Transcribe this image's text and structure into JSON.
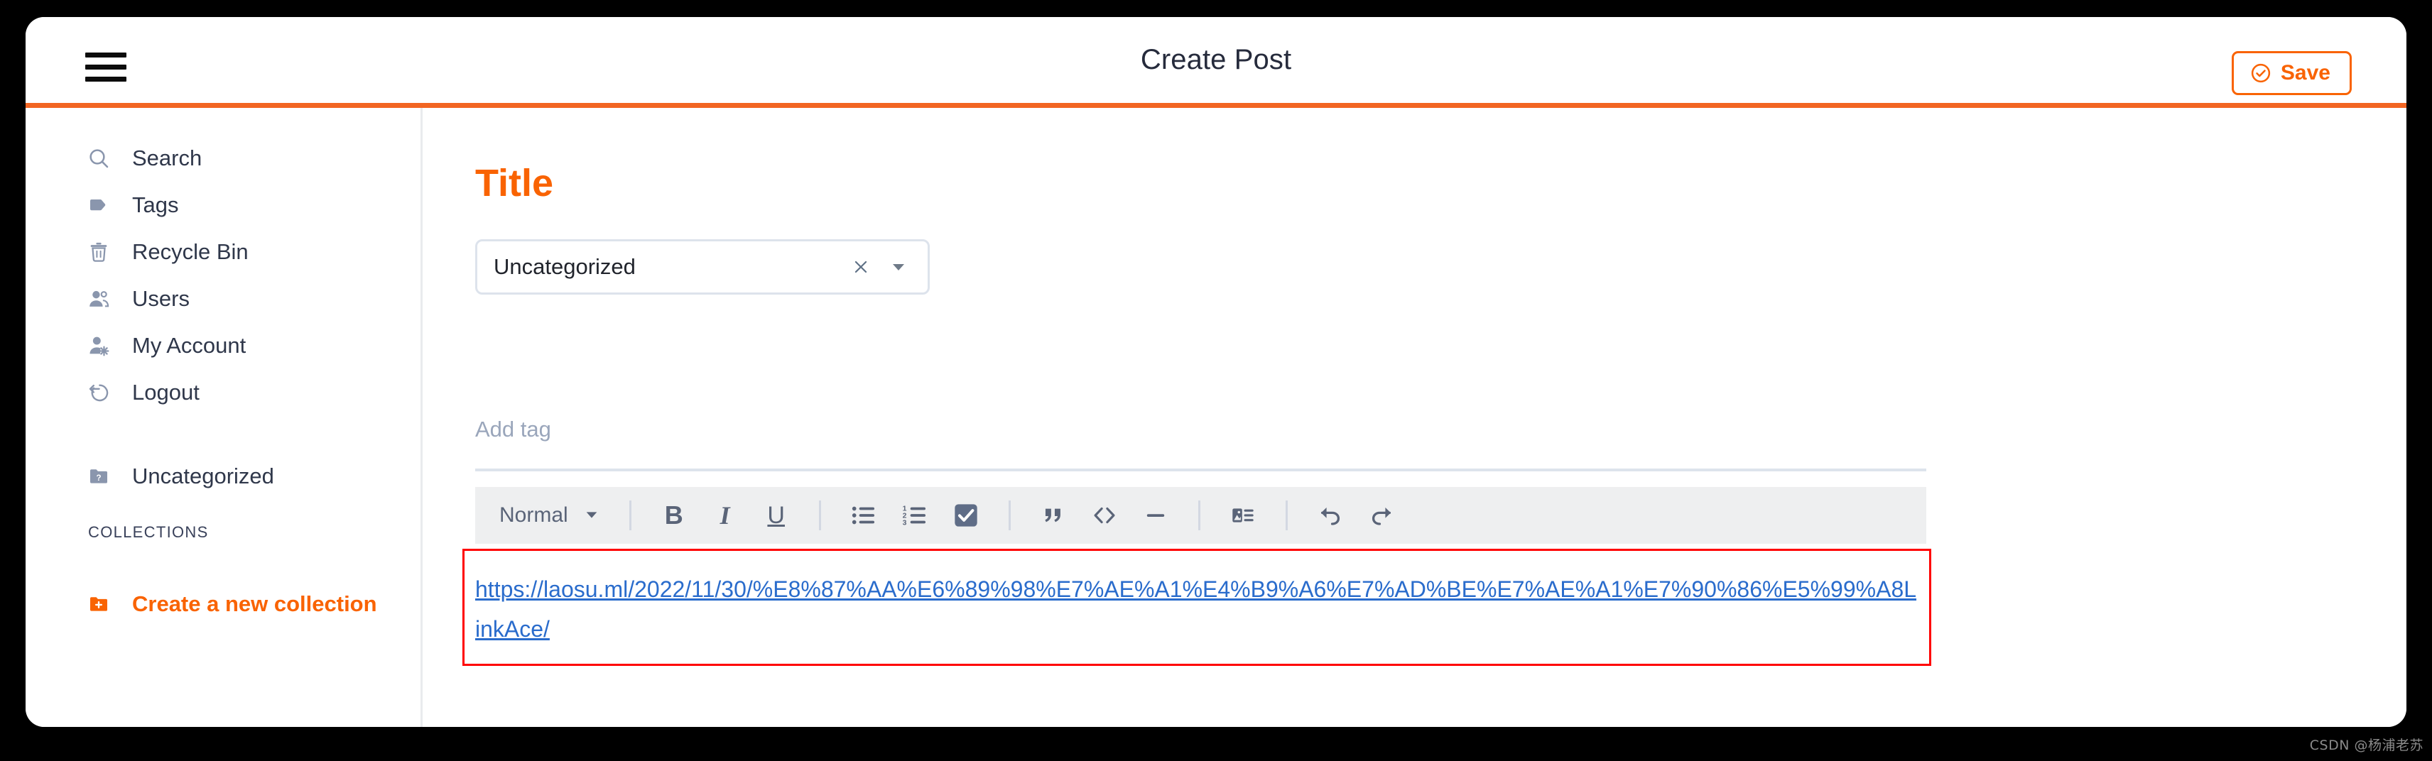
{
  "header": {
    "menu_icon": "hamburger-icon",
    "title": "Create Post",
    "save_label": "Save",
    "save_icon": "check-circle-icon",
    "accent_color": "#f96302",
    "divider_color": "#f26522"
  },
  "sidebar": {
    "items": [
      {
        "label": "Search",
        "icon": "search-icon"
      },
      {
        "label": "Tags",
        "icon": "tag-icon"
      },
      {
        "label": "Recycle Bin",
        "icon": "trash-icon"
      },
      {
        "label": "Users",
        "icon": "users-icon"
      },
      {
        "label": "My Account",
        "icon": "user-gear-icon"
      },
      {
        "label": "Logout",
        "icon": "logout-icon"
      }
    ],
    "collection_item": {
      "label": "Uncategorized",
      "icon": "folder-question-icon"
    },
    "collections_heading": "COLLECTIONS",
    "create_collection": {
      "label": "Create a new collection",
      "icon": "folder-plus-icon",
      "color": "#f96302"
    }
  },
  "main": {
    "title_field": {
      "value": "",
      "placeholder": "Title",
      "color": "#f96302"
    },
    "category_select": {
      "value": "Uncategorized",
      "clear_icon": "close-icon",
      "caret_icon": "chevron-down-icon"
    },
    "tag_field": {
      "value": "",
      "placeholder": "Add tag"
    },
    "toolbar": {
      "format": {
        "label": "Normal",
        "caret_icon": "chevron-down-icon"
      },
      "buttons": [
        {
          "name": "bold",
          "glyph": "B",
          "icon": "bold-icon"
        },
        {
          "name": "italic",
          "glyph": "I",
          "icon": "italic-icon"
        },
        {
          "name": "underline",
          "glyph": "U",
          "icon": "underline-icon"
        },
        {
          "name": "bullet-list",
          "glyph": "",
          "icon": "bullet-list-icon"
        },
        {
          "name": "numbered-list",
          "glyph": "",
          "icon": "numbered-list-icon"
        },
        {
          "name": "checklist",
          "glyph": "",
          "icon": "checkbox-checked-icon",
          "active": true
        },
        {
          "name": "blockquote",
          "glyph": "",
          "icon": "quote-icon"
        },
        {
          "name": "code-block",
          "glyph": "",
          "icon": "code-icon"
        },
        {
          "name": "horizontal-rule",
          "glyph": "",
          "icon": "minus-icon"
        },
        {
          "name": "insert-media",
          "glyph": "",
          "icon": "image-text-icon"
        },
        {
          "name": "undo",
          "glyph": "",
          "icon": "undo-icon"
        },
        {
          "name": "redo",
          "glyph": "",
          "icon": "redo-icon"
        }
      ]
    },
    "content_link": "https://laosu.ml/2022/11/30/%E8%87%AA%E6%89%98%E7%AE%A1%E4%B9%A6%E7%AD%BE%E7%AE%A1%E7%90%86%E5%99%A8LinkAce/"
  },
  "annotation": {
    "border_color": "#ff0000"
  },
  "watermark": "CSDN @杨浦老苏"
}
